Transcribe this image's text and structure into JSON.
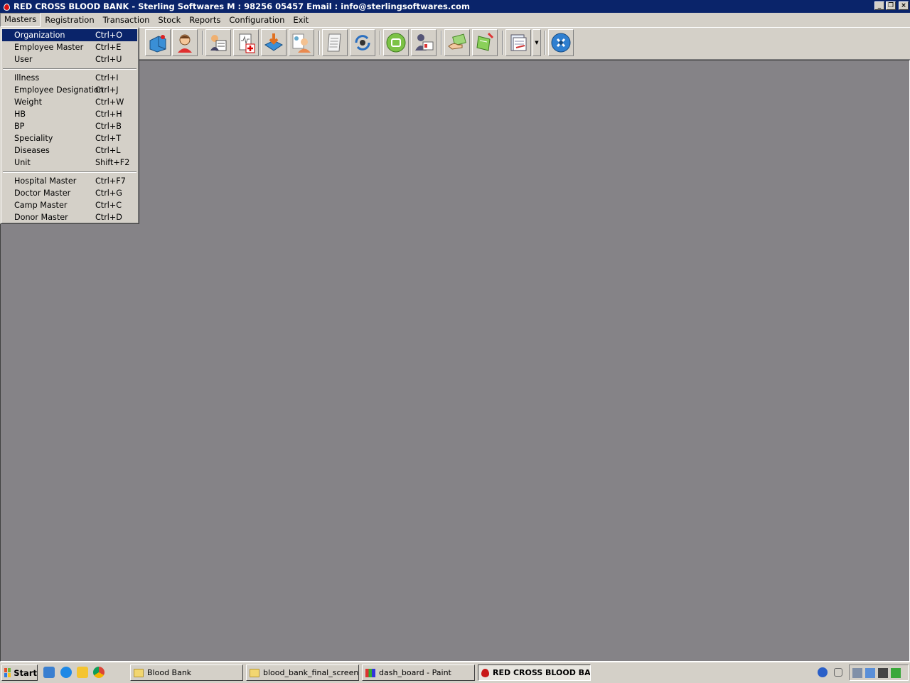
{
  "window": {
    "title": "RED CROSS BLOOD BANK - Sterling Softwares  M : 98256 05457 Email : info@sterlingsoftwares.com",
    "minimize_glyph": "_",
    "restore_glyph": "❐",
    "close_glyph": "×"
  },
  "menubar": {
    "items": [
      {
        "label": "Masters",
        "active": true
      },
      {
        "label": "Registration"
      },
      {
        "label": "Transaction"
      },
      {
        "label": "Stock"
      },
      {
        "label": "Reports"
      },
      {
        "label": "Configuration"
      },
      {
        "label": "Exit"
      }
    ]
  },
  "masters_menu": {
    "groups": [
      [
        {
          "label": "Organization",
          "shortcut": "Ctrl+O",
          "selected": true
        },
        {
          "label": "Employee Master",
          "shortcut": "Ctrl+E"
        },
        {
          "label": "User",
          "shortcut": "Ctrl+U"
        }
      ],
      [
        {
          "label": "Illness",
          "shortcut": "Ctrl+I"
        },
        {
          "label": "Employee Designation",
          "shortcut": "Ctrl+J"
        },
        {
          "label": "Weight",
          "shortcut": "Ctrl+W"
        },
        {
          "label": "HB",
          "shortcut": "Ctrl+H"
        },
        {
          "label": "BP",
          "shortcut": "Ctrl+B"
        },
        {
          "label": "Speciality",
          "shortcut": "Ctrl+T"
        },
        {
          "label": "Diseases",
          "shortcut": "Ctrl+L"
        },
        {
          "label": "Unit",
          "shortcut": "Shift+F2"
        }
      ],
      [
        {
          "label": "Hospital Master",
          "shortcut": "Ctrl+F7"
        },
        {
          "label": "Doctor Master",
          "shortcut": "Ctrl+G"
        },
        {
          "label": "Camp Master",
          "shortcut": "Ctrl+C"
        },
        {
          "label": "Donor Master",
          "shortcut": "Ctrl+D"
        }
      ]
    ]
  },
  "toolbar": {
    "icons": [
      "blood-bag-icon",
      "donor-person-icon",
      "registration-form-icon",
      "medical-report-icon",
      "blood-issue-icon",
      "patient-icon",
      "document-icon",
      "refresh-settings-icon",
      "camera-icon",
      "id-card-icon",
      "payment-icon",
      "cross-match-icon",
      "report-sheet-icon",
      "tools-icon"
    ]
  },
  "taskbar": {
    "start_label": "Start",
    "tasks": [
      {
        "label": "Blood Bank",
        "icon": "folder-icon"
      },
      {
        "label": "blood_bank_final_screen...",
        "icon": "folder-icon"
      },
      {
        "label": "dash_board - Paint",
        "icon": "paint-icon"
      },
      {
        "label": "RED CROSS BLOOD BA...",
        "icon": "blood-drop-icon",
        "active": true
      }
    ]
  },
  "colors": {
    "title_bar": "#0a246a",
    "mdi_background": "#858387",
    "chrome": "#d4d0c8",
    "selection": "#0a246a"
  }
}
